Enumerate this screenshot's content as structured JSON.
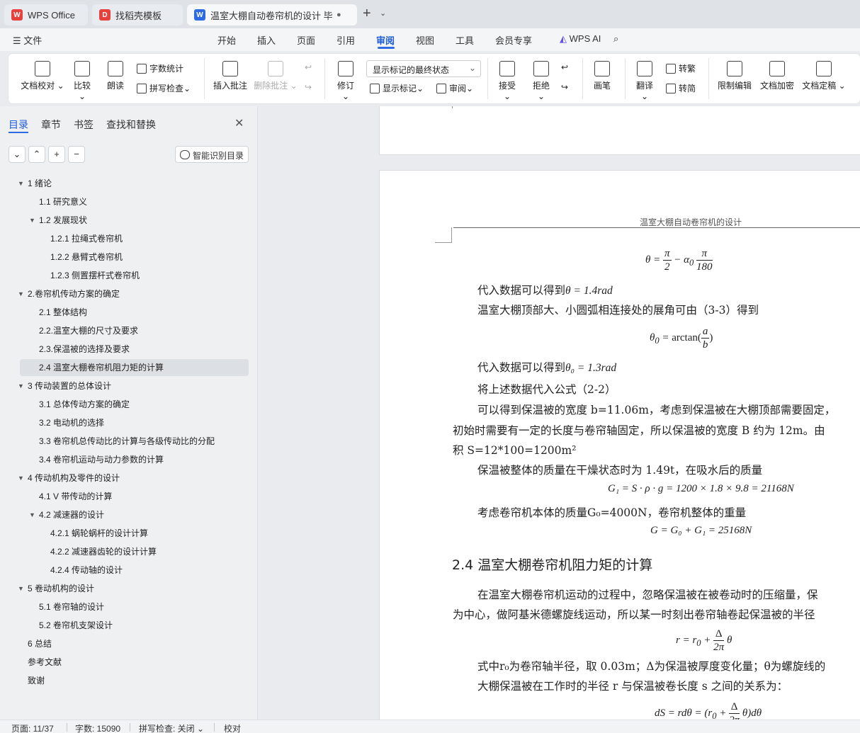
{
  "tabs": [
    {
      "label": "WPS Office",
      "logo": "wps-logo"
    },
    {
      "label": "找稻壳模板",
      "logo": "docer-logo"
    },
    {
      "label": "温室大棚自动卷帘机的设计 毕",
      "logo": "writer-logo"
    }
  ],
  "menu": {
    "file": "文件",
    "items": [
      "开始",
      "插入",
      "页面",
      "引用",
      "审阅",
      "视图",
      "工具",
      "会员专享"
    ],
    "active": "审阅",
    "wps_ai": "WPS AI"
  },
  "ribbon": {
    "doc_proofread": "文档校对",
    "compare": "比较",
    "read_aloud": "朗读",
    "word_count": "字数统计",
    "spell_check": "拼写检查",
    "insert_comment": "插入批注",
    "delete_comment": "删除批注",
    "track_changes": "修订",
    "markup_select": "显示标记的最终状态",
    "show_markup": "显示标记",
    "review": "审阅",
    "accept": "接受",
    "reject": "拒绝",
    "ink": "画笔",
    "translate": "翻译",
    "to_traditional": "转繁",
    "to_simplified": "转简",
    "restrict_edit": "限制编辑",
    "encrypt": "文档加密",
    "finalize": "文档定稿"
  },
  "panel": {
    "tabs": [
      "目录",
      "章节",
      "书签",
      "查找和替换"
    ],
    "smart_toc": "智能识别目录",
    "toc": [
      {
        "label": "1   绪论",
        "level": 1,
        "expand": true
      },
      {
        "label": "1.1 研究意义",
        "level": 2
      },
      {
        "label": "1.2 发展现状",
        "level": 2,
        "expand": true
      },
      {
        "label": "1.2.1  拉绳式卷帘机",
        "level": 3
      },
      {
        "label": "1.2.2  悬臂式卷帘机",
        "level": 3
      },
      {
        "label": "1.2.3  侧置摆杆式卷帘机",
        "level": 3
      },
      {
        "label": "2.卷帘机传动方案的确定",
        "level": 1,
        "expand": true
      },
      {
        "label": "2.1 整体结构",
        "level": 2
      },
      {
        "label": "2.2.温室大棚的尺寸及要求",
        "level": 2
      },
      {
        "label": "2.3.保温被的选择及要求",
        "level": 2
      },
      {
        "label": "2.4 温室大棚卷帘机阻力矩的计算",
        "level": 2,
        "selected": true
      },
      {
        "label": "3 传动装置的总体设计",
        "level": 1,
        "expand": true
      },
      {
        "label": "3.1 总体传动方案的确定",
        "level": 2
      },
      {
        "label": "3.2 电动机的选择",
        "level": 2
      },
      {
        "label": "3.3  卷帘机总传动比的计算与各级传动比的分配",
        "level": 2
      },
      {
        "label": "3.4  卷帘机运动与动力参数的计算",
        "level": 2
      },
      {
        "label": "4 传动机构及零件的设计",
        "level": 1,
        "expand": true
      },
      {
        "label": "4.1 V 带传动的计算",
        "level": 2
      },
      {
        "label": "4.2 减速器的设计",
        "level": 2,
        "expand": true
      },
      {
        "label": "4.2.1  蜗轮蜗杆的设计计算",
        "level": 3
      },
      {
        "label": "4.2.2 减速器齿轮的设计计算",
        "level": 3
      },
      {
        "label": "4.2.4  传动轴的设计",
        "level": 3
      },
      {
        "label": "5 卷动机构的设计",
        "level": 1,
        "expand": true
      },
      {
        "label": "5.1 卷帘轴的设计",
        "level": 2
      },
      {
        "label": "5.2 卷帘机支架设计",
        "level": 2
      },
      {
        "label": "6 总结",
        "level": 1
      },
      {
        "label": "参考文献",
        "level": 1
      },
      {
        "label": "致谢",
        "level": 1
      }
    ]
  },
  "doc": {
    "header": "温室大棚自动卷帘机的设计",
    "p1": "代入数据可以得到",
    "p1_val": "θ = 1.4rad",
    "p2": "温室大棚顶部大、小圆弧相连接处的展角可由（3-3）得到",
    "p3": "代入数据可以得到",
    "p3_val": "θ₀ = 1.3rad",
    "p4": "将上述数据代入公式（2-2）",
    "p5": "可以得到保温被的宽度 b=11.06m，考虑到保温被在大棚顶部需要固定，",
    "p6": "初始时需要有一定的长度与卷帘轴固定，所以保温被的宽度 B 约为 12m。由",
    "p7": "积 S=12*100=1200m²",
    "p8": "保温被整体的质量在干燥状态时为 1.49t，在吸水后的质量",
    "f3": "G₁ = S · ρ · g = 1200 × 1.8 × 9.8 = 21168N",
    "p9": "考虑卷帘机本体的质量G₀=4000N，卷帘机整体的重量",
    "f4": "G = G₀ + G₁ = 25168N",
    "h2": "2.4 温室大棚卷帘机阻力矩的计算",
    "p10": "在温室大棚卷帘机运动的过程中，忽略保温被在被卷动时的压缩量，保",
    "p11": "为中心，做阿基米德螺旋线运动，所以某一时刻出卷帘轴卷起保温被的半径",
    "p12": "式中r₀为卷帘轴半径，取 0.03m；Δ为保温被厚度变化量；θ为螺旋线的",
    "p13": "大棚保温被在工作时的半径 r 与保温被卷长度 s 之间的关系为："
  },
  "status": {
    "page": "页面: 11/37",
    "words": "字数: 15090",
    "spell": "拼写检查: 关闭",
    "proof": "校对"
  }
}
